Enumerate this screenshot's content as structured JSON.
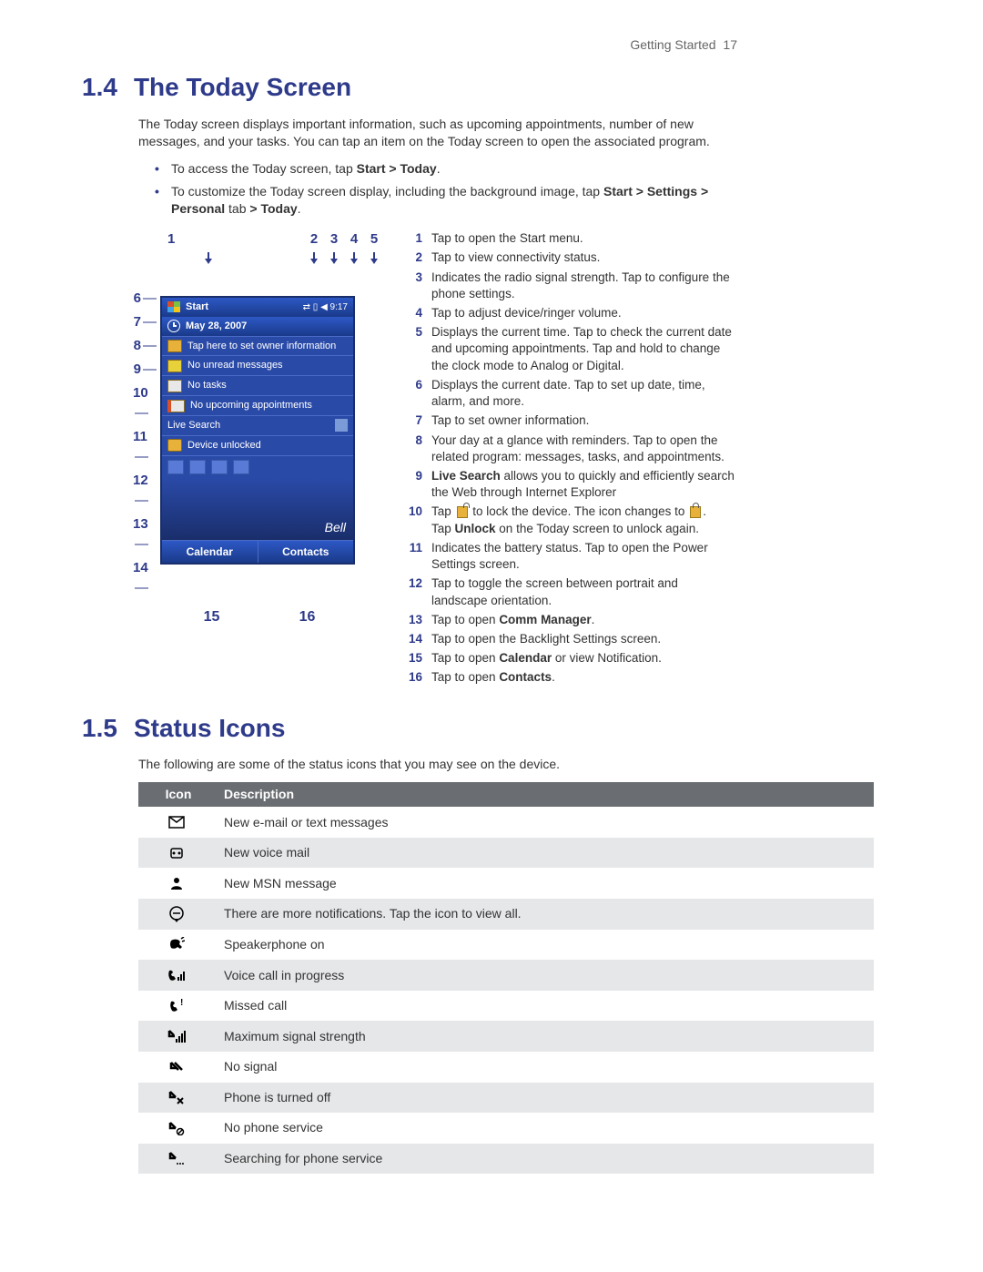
{
  "header": {
    "section": "Getting Started",
    "page": "17"
  },
  "sec14": {
    "num": "1.4",
    "title": "The Today Screen",
    "intro": "The Today screen displays important information, such as upcoming appointments, number of new messages, and your tasks. You can tap an item on the Today screen to open the associated program.",
    "bullet1_pre": "To access the Today screen, tap ",
    "bullet1_bold": "Start > Today",
    "bullet1_post": ".",
    "bullet2_pre": "To customize the Today screen display, including the background image, tap ",
    "bullet2_bold1": "Start > Settings > Personal",
    "bullet2_mid": " tab ",
    "bullet2_bold2": "> Today",
    "bullet2_post": "."
  },
  "phone": {
    "start": "Start",
    "status_icons": "⇄ ▯ ◀ 9:17",
    "date": "May 28, 2007",
    "owner": "Tap here to set owner information",
    "msgs": "No unread messages",
    "tasks": "No tasks",
    "appts": "No upcoming appointments",
    "livesearch": "Live Search",
    "unlocked": "Device unlocked",
    "brand": "Bell",
    "soft_left": "Calendar",
    "soft_right": "Contacts"
  },
  "callouts_top": [
    "1",
    "2",
    "3",
    "4",
    "5"
  ],
  "callouts_side": [
    "6",
    "7",
    "8",
    "9",
    "10",
    "11",
    "12",
    "13",
    "14"
  ],
  "callouts_bottom": [
    "15",
    "16"
  ],
  "legend": [
    {
      "n": "1",
      "t": "Tap to open the Start menu."
    },
    {
      "n": "2",
      "t": "Tap to view connectivity status."
    },
    {
      "n": "3",
      "t": "Indicates the radio signal strength. Tap to configure the phone settings."
    },
    {
      "n": "4",
      "t": "Tap to adjust device/ringer volume."
    },
    {
      "n": "5",
      "t": "Displays the current time. Tap to check the current date and upcoming appointments. Tap and hold to change the clock mode to Analog or Digital."
    },
    {
      "n": "6",
      "t": "Displays the current date. Tap to set up date, time, alarm, and more."
    },
    {
      "n": "7",
      "t": "Tap to set owner information."
    },
    {
      "n": "8",
      "t": "Your day at a glance with reminders. Tap to open the related program: messages, tasks, and appointments."
    },
    {
      "n": "9",
      "pre": "",
      "bold1": "Live Search",
      "mid": " allows you to quickly and efficiently search the Web through Internet Explorer"
    },
    {
      "n": "10",
      "pre": "Tap ",
      "icon": "open",
      "mid": " to lock the device. The icon changes to ",
      "icon2": "closed",
      "post1": ".",
      "line2_pre": "Tap ",
      "line2_bold": "Unlock",
      "line2_post": " on the Today screen to unlock again."
    },
    {
      "n": "11",
      "t": "Indicates the battery status. Tap to open the Power Settings screen."
    },
    {
      "n": "12",
      "t": "Tap to toggle the screen between portrait and landscape orientation."
    },
    {
      "n": "13",
      "pre": "Tap to open ",
      "bold1": "Comm Manager",
      "post": "."
    },
    {
      "n": "14",
      "t": "Tap to open the Backlight Settings screen."
    },
    {
      "n": "15",
      "pre": "Tap to open ",
      "bold1": "Calendar",
      "post": " or view Notification."
    },
    {
      "n": "16",
      "pre": "Tap to open ",
      "bold1": "Contacts",
      "post": "."
    }
  ],
  "sec15": {
    "num": "1.5",
    "title": "Status Icons",
    "intro": "The following are some of the status icons that you may see on the device.",
    "th_icon": "Icon",
    "th_desc": "Description",
    "rows": [
      {
        "desc": "New e-mail or text messages"
      },
      {
        "desc": "New voice mail"
      },
      {
        "desc": "New MSN message"
      },
      {
        "desc": "There are more notifications. Tap the icon to view all."
      },
      {
        "desc": "Speakerphone on"
      },
      {
        "desc": "Voice call in progress"
      },
      {
        "desc": "Missed call"
      },
      {
        "desc": "Maximum signal strength"
      },
      {
        "desc": "No signal"
      },
      {
        "desc": "Phone is turned off"
      },
      {
        "desc": "No phone service"
      },
      {
        "desc": "Searching for phone service"
      }
    ]
  }
}
